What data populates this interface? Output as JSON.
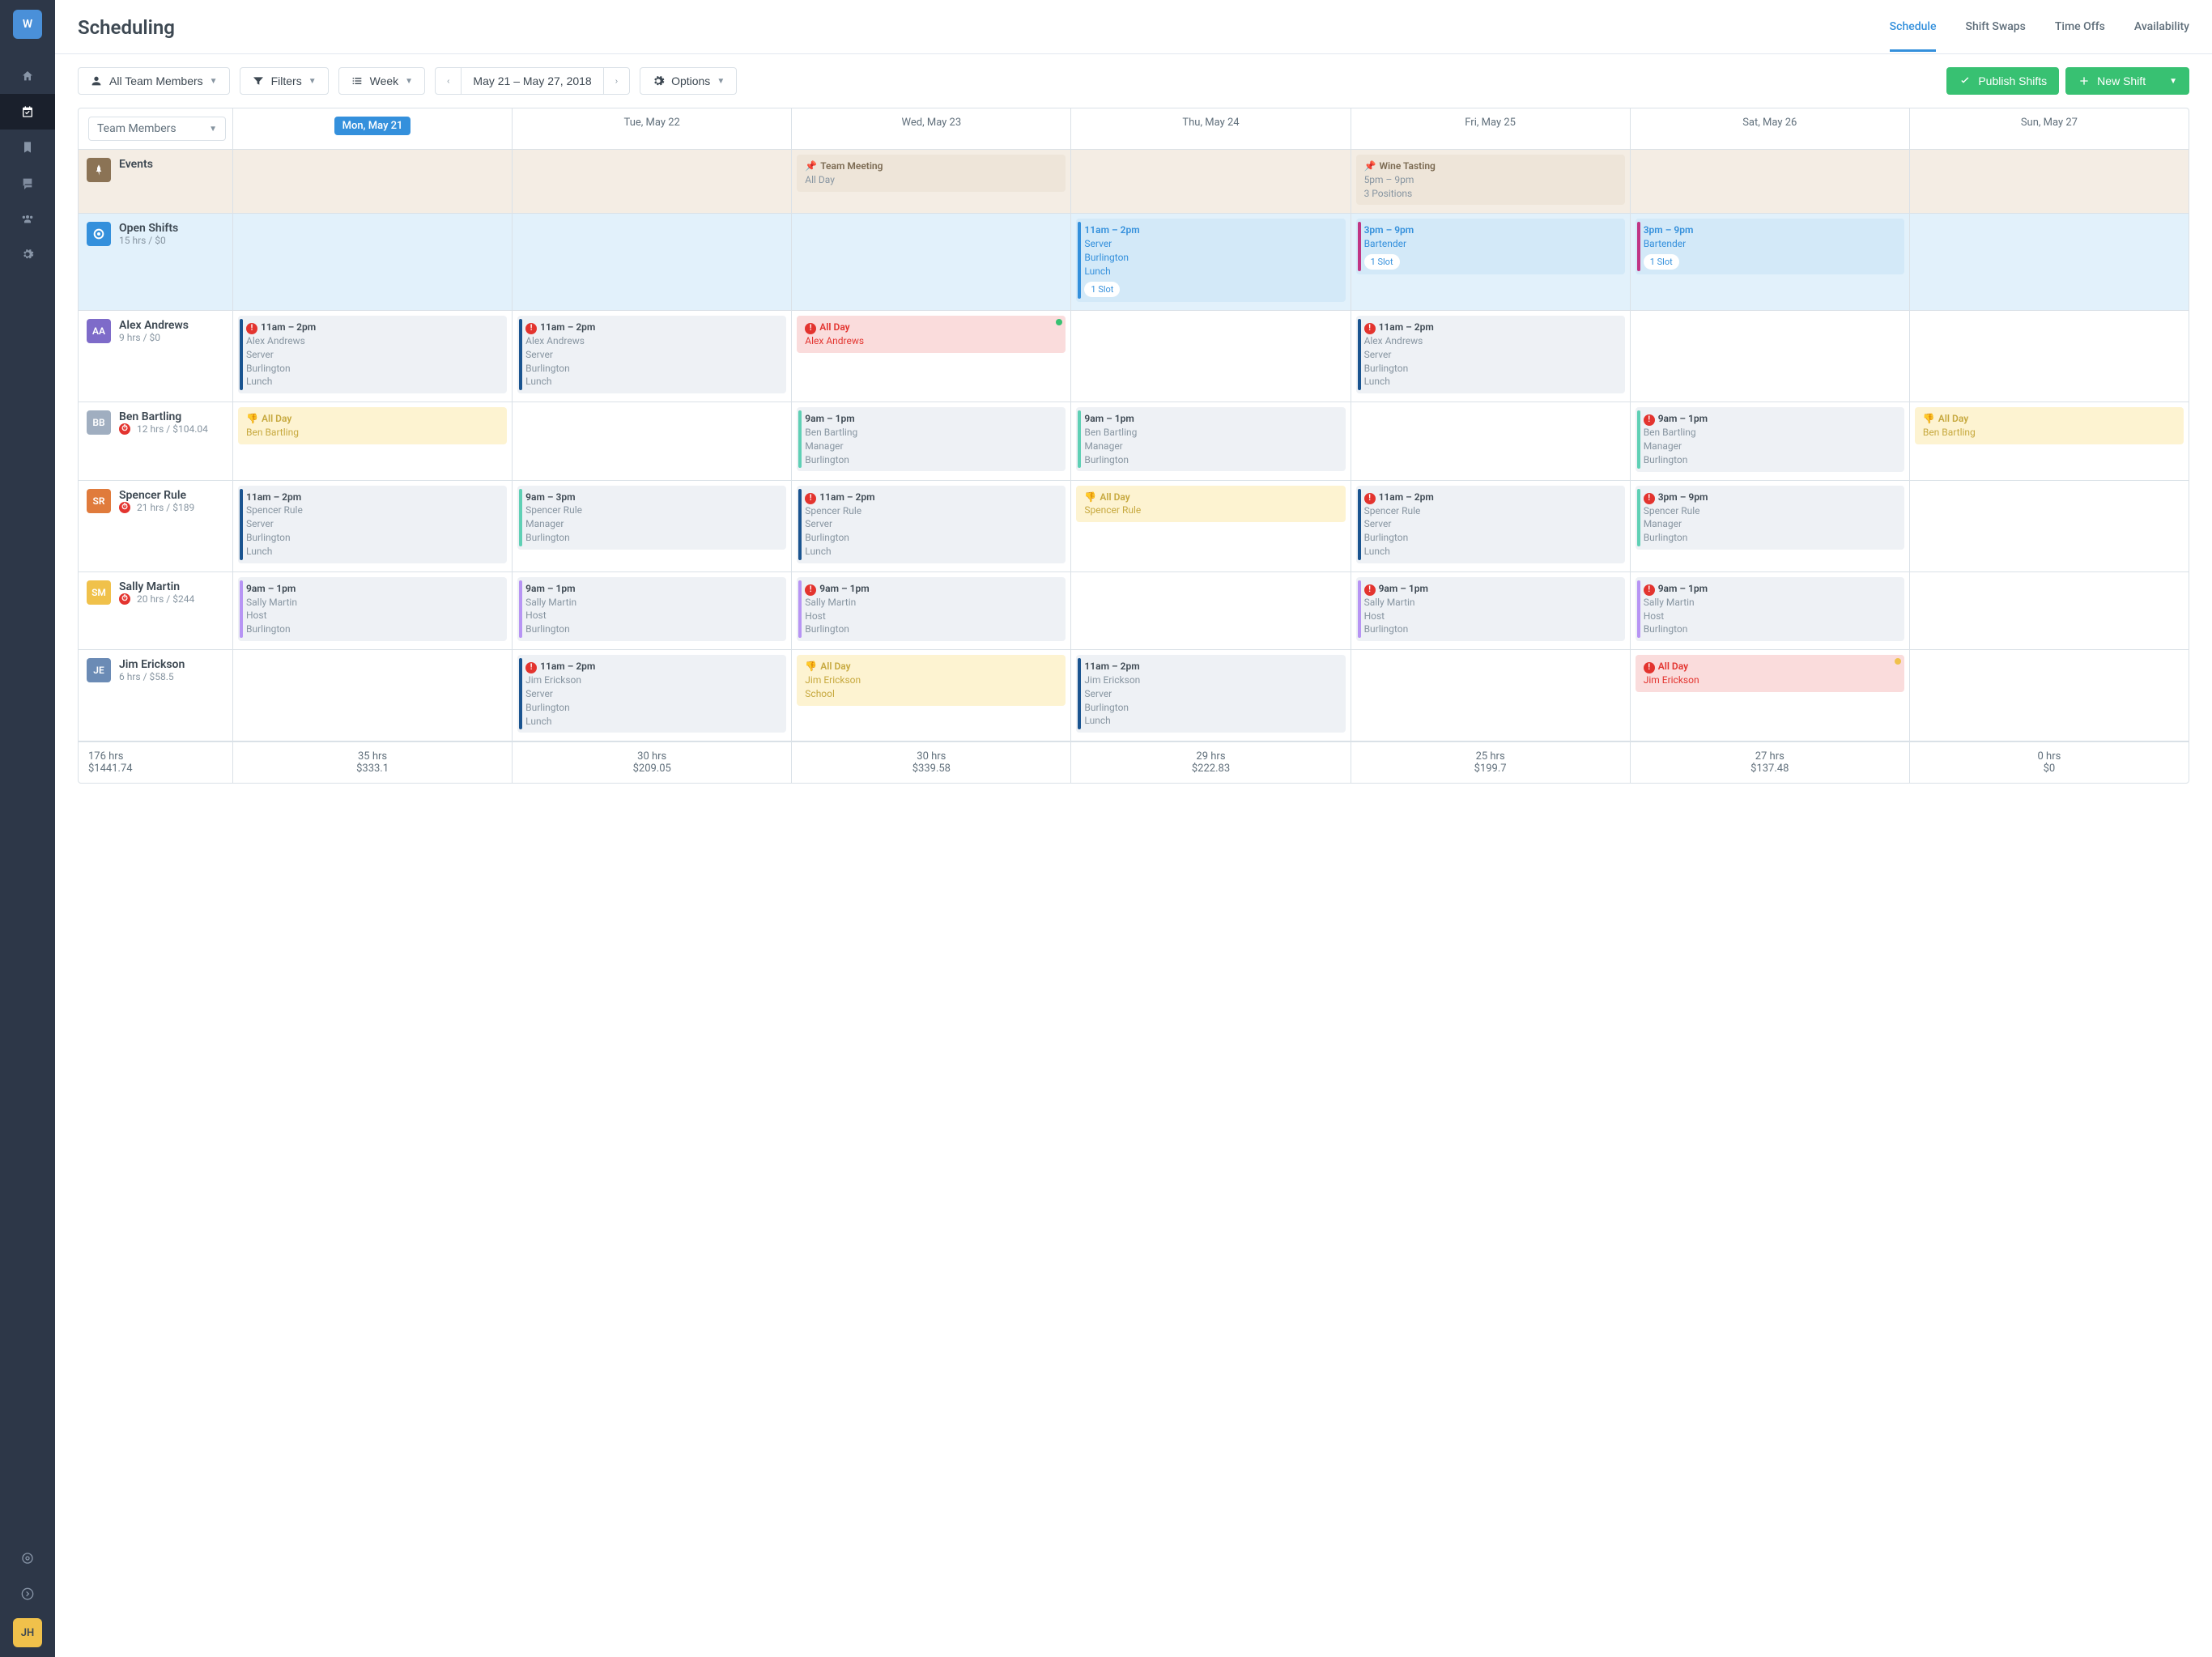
{
  "sidebar": {
    "logo": "W",
    "avatar": "JH"
  },
  "header": {
    "title": "Scheduling",
    "tabs": [
      "Schedule",
      "Shift Swaps",
      "Time Offs",
      "Availability"
    ],
    "activeTab": 0
  },
  "toolbar": {
    "teamFilter": "All Team Members",
    "filters": "Filters",
    "viewMode": "Week",
    "dateRange": "May 21 – May 27, 2018",
    "options": "Options",
    "publish": "Publish Shifts",
    "newShift": "New Shift"
  },
  "columns": {
    "firstHeader": "Team Members",
    "days": [
      "Mon, May 21",
      "Tue, May 22",
      "Wed, May 23",
      "Thu, May 24",
      "Fri, May 25",
      "Sat, May 26",
      "Sun, May 27"
    ],
    "activeDay": 0
  },
  "rows": [
    {
      "id": "events",
      "name": "Events",
      "iconBg": "#8b7355",
      "iconType": "pin",
      "cells": [
        null,
        null,
        {
          "type": "event",
          "title": "Team Meeting",
          "lines": [
            "All Day"
          ]
        },
        null,
        {
          "type": "event",
          "title": "Wine Tasting",
          "lines": [
            "5pm – 9pm",
            "3 Positions"
          ]
        },
        null,
        null
      ]
    },
    {
      "id": "open",
      "name": "Open Shifts",
      "meta": "15 hrs / $0",
      "iconBg": "#3490dc",
      "iconType": "target",
      "cells": [
        null,
        null,
        null,
        {
          "type": "open",
          "stripe": "#3490dc",
          "title": "11am – 2pm",
          "lines": [
            "Server",
            "Burlington",
            "Lunch"
          ],
          "slot": "1 Slot"
        },
        {
          "type": "open",
          "stripe": "#c13584",
          "title": "3pm – 9pm",
          "lines": [
            "Bartender"
          ],
          "slot": "1 Slot"
        },
        {
          "type": "open",
          "stripe": "#c13584",
          "title": "3pm – 9pm",
          "lines": [
            "Bartender"
          ],
          "slot": "1 Slot"
        },
        null
      ]
    },
    {
      "id": "alex",
      "name": "Alex Andrews",
      "meta": "9 hrs / $0",
      "initials": "AA",
      "iconBg": "#7e6bc9",
      "cells": [
        {
          "type": "shift",
          "alert": true,
          "stripe": "#1a5490",
          "title": "11am – 2pm",
          "lines": [
            "Alex Andrews",
            "Server",
            "Burlington",
            "Lunch"
          ]
        },
        {
          "type": "shift",
          "alert": true,
          "stripe": "#1a5490",
          "title": "11am – 2pm",
          "lines": [
            "Alex Andrews",
            "Server",
            "Burlington",
            "Lunch"
          ]
        },
        {
          "type": "unavail",
          "alert": true,
          "title": "All Day",
          "lines": [
            "Alex Andrews"
          ],
          "greenDot": true
        },
        null,
        {
          "type": "shift",
          "alert": true,
          "stripe": "#1a5490",
          "title": "11am – 2pm",
          "lines": [
            "Alex Andrews",
            "Server",
            "Burlington",
            "Lunch"
          ]
        },
        null,
        null
      ]
    },
    {
      "id": "ben",
      "name": "Ben Bartling",
      "meta": "12 hrs / $104.04",
      "metaAlert": true,
      "initials": "BB",
      "iconBg": "#a0aec0",
      "cells": [
        {
          "type": "timeoff",
          "thumbs": true,
          "title": "All Day",
          "lines": [
            "Ben Bartling"
          ]
        },
        null,
        {
          "type": "shift",
          "stripe": "#5fd0b5",
          "title": "9am – 1pm",
          "lines": [
            "Ben Bartling",
            "Manager",
            "Burlington"
          ]
        },
        {
          "type": "shift",
          "stripe": "#5fd0b5",
          "title": "9am – 1pm",
          "lines": [
            "Ben Bartling",
            "Manager",
            "Burlington"
          ]
        },
        null,
        {
          "type": "shift",
          "alert": true,
          "stripe": "#5fd0b5",
          "title": "9am – 1pm",
          "lines": [
            "Ben Bartling",
            "Manager",
            "Burlington"
          ]
        },
        {
          "type": "timeoff",
          "thumbs": true,
          "title": "All Day",
          "lines": [
            "Ben Bartling"
          ]
        }
      ]
    },
    {
      "id": "spencer",
      "name": "Spencer Rule",
      "meta": "21 hrs / $189",
      "metaAlert": true,
      "initials": "SR",
      "iconBg": "#e07b3c",
      "cells": [
        {
          "type": "shift",
          "stripe": "#1a5490",
          "title": "11am – 2pm",
          "lines": [
            "Spencer Rule",
            "Server",
            "Burlington",
            "Lunch"
          ]
        },
        {
          "type": "shift",
          "stripe": "#5fd0b5",
          "title": "9am – 3pm",
          "lines": [
            "Spencer Rule",
            "Manager",
            "Burlington"
          ]
        },
        {
          "type": "shift",
          "alert": true,
          "stripe": "#1a5490",
          "title": "11am – 2pm",
          "lines": [
            "Spencer Rule",
            "Server",
            "Burlington",
            "Lunch"
          ]
        },
        {
          "type": "timeoff",
          "thumbs": true,
          "title": "All Day",
          "lines": [
            "Spencer Rule"
          ]
        },
        {
          "type": "shift",
          "alert": true,
          "stripe": "#1a5490",
          "title": "11am – 2pm",
          "lines": [
            "Spencer Rule",
            "Server",
            "Burlington",
            "Lunch"
          ]
        },
        {
          "type": "shift",
          "alert": true,
          "stripe": "#5fd0b5",
          "title": "3pm – 9pm",
          "lines": [
            "Spencer Rule",
            "Manager",
            "Burlington"
          ]
        },
        null
      ]
    },
    {
      "id": "sally",
      "name": "Sally Martin",
      "meta": "20 hrs / $244",
      "metaAlert": true,
      "initials": "SM",
      "iconBg": "#f0c14b",
      "cells": [
        {
          "type": "shift",
          "stripe": "#b794f4",
          "title": "9am – 1pm",
          "lines": [
            "Sally Martin",
            "Host",
            "Burlington"
          ]
        },
        {
          "type": "shift",
          "stripe": "#b794f4",
          "title": "9am – 1pm",
          "lines": [
            "Sally Martin",
            "Host",
            "Burlington"
          ]
        },
        {
          "type": "shift",
          "alert": true,
          "stripe": "#b794f4",
          "title": "9am – 1pm",
          "lines": [
            "Sally Martin",
            "Host",
            "Burlington"
          ]
        },
        null,
        {
          "type": "shift",
          "alert": true,
          "stripe": "#b794f4",
          "title": "9am – 1pm",
          "lines": [
            "Sally Martin",
            "Host",
            "Burlington"
          ]
        },
        {
          "type": "shift",
          "alert": true,
          "stripe": "#b794f4",
          "title": "9am – 1pm",
          "lines": [
            "Sally Martin",
            "Host",
            "Burlington"
          ]
        },
        null
      ]
    },
    {
      "id": "jim",
      "name": "Jim Erickson",
      "meta": "6 hrs / $58.5",
      "initials": "JE",
      "iconBg": "#6b8bb5",
      "cells": [
        null,
        {
          "type": "shift",
          "alert": true,
          "stripe": "#1a5490",
          "title": "11am – 2pm",
          "lines": [
            "Jim Erickson",
            "Server",
            "Burlington",
            "Lunch"
          ]
        },
        {
          "type": "timeoff",
          "thumbs": true,
          "title": "All Day",
          "lines": [
            "Jim Erickson",
            "School"
          ]
        },
        {
          "type": "shift",
          "stripe": "#1a5490",
          "title": "11am – 2pm",
          "lines": [
            "Jim Erickson",
            "Server",
            "Burlington",
            "Lunch"
          ]
        },
        null,
        {
          "type": "unavail",
          "alert": true,
          "title": "All Day",
          "lines": [
            "Jim Erickson"
          ],
          "yellowDot": true
        },
        null
      ]
    }
  ],
  "footer": {
    "total": {
      "hrs": "176 hrs",
      "amt": "$1441.74"
    },
    "days": [
      {
        "hrs": "35 hrs",
        "amt": "$333.1"
      },
      {
        "hrs": "30 hrs",
        "amt": "$209.05"
      },
      {
        "hrs": "30 hrs",
        "amt": "$339.58"
      },
      {
        "hrs": "29 hrs",
        "amt": "$222.83"
      },
      {
        "hrs": "25 hrs",
        "amt": "$199.7"
      },
      {
        "hrs": "27 hrs",
        "amt": "$137.48"
      },
      {
        "hrs": "0 hrs",
        "amt": "$0"
      }
    ]
  }
}
